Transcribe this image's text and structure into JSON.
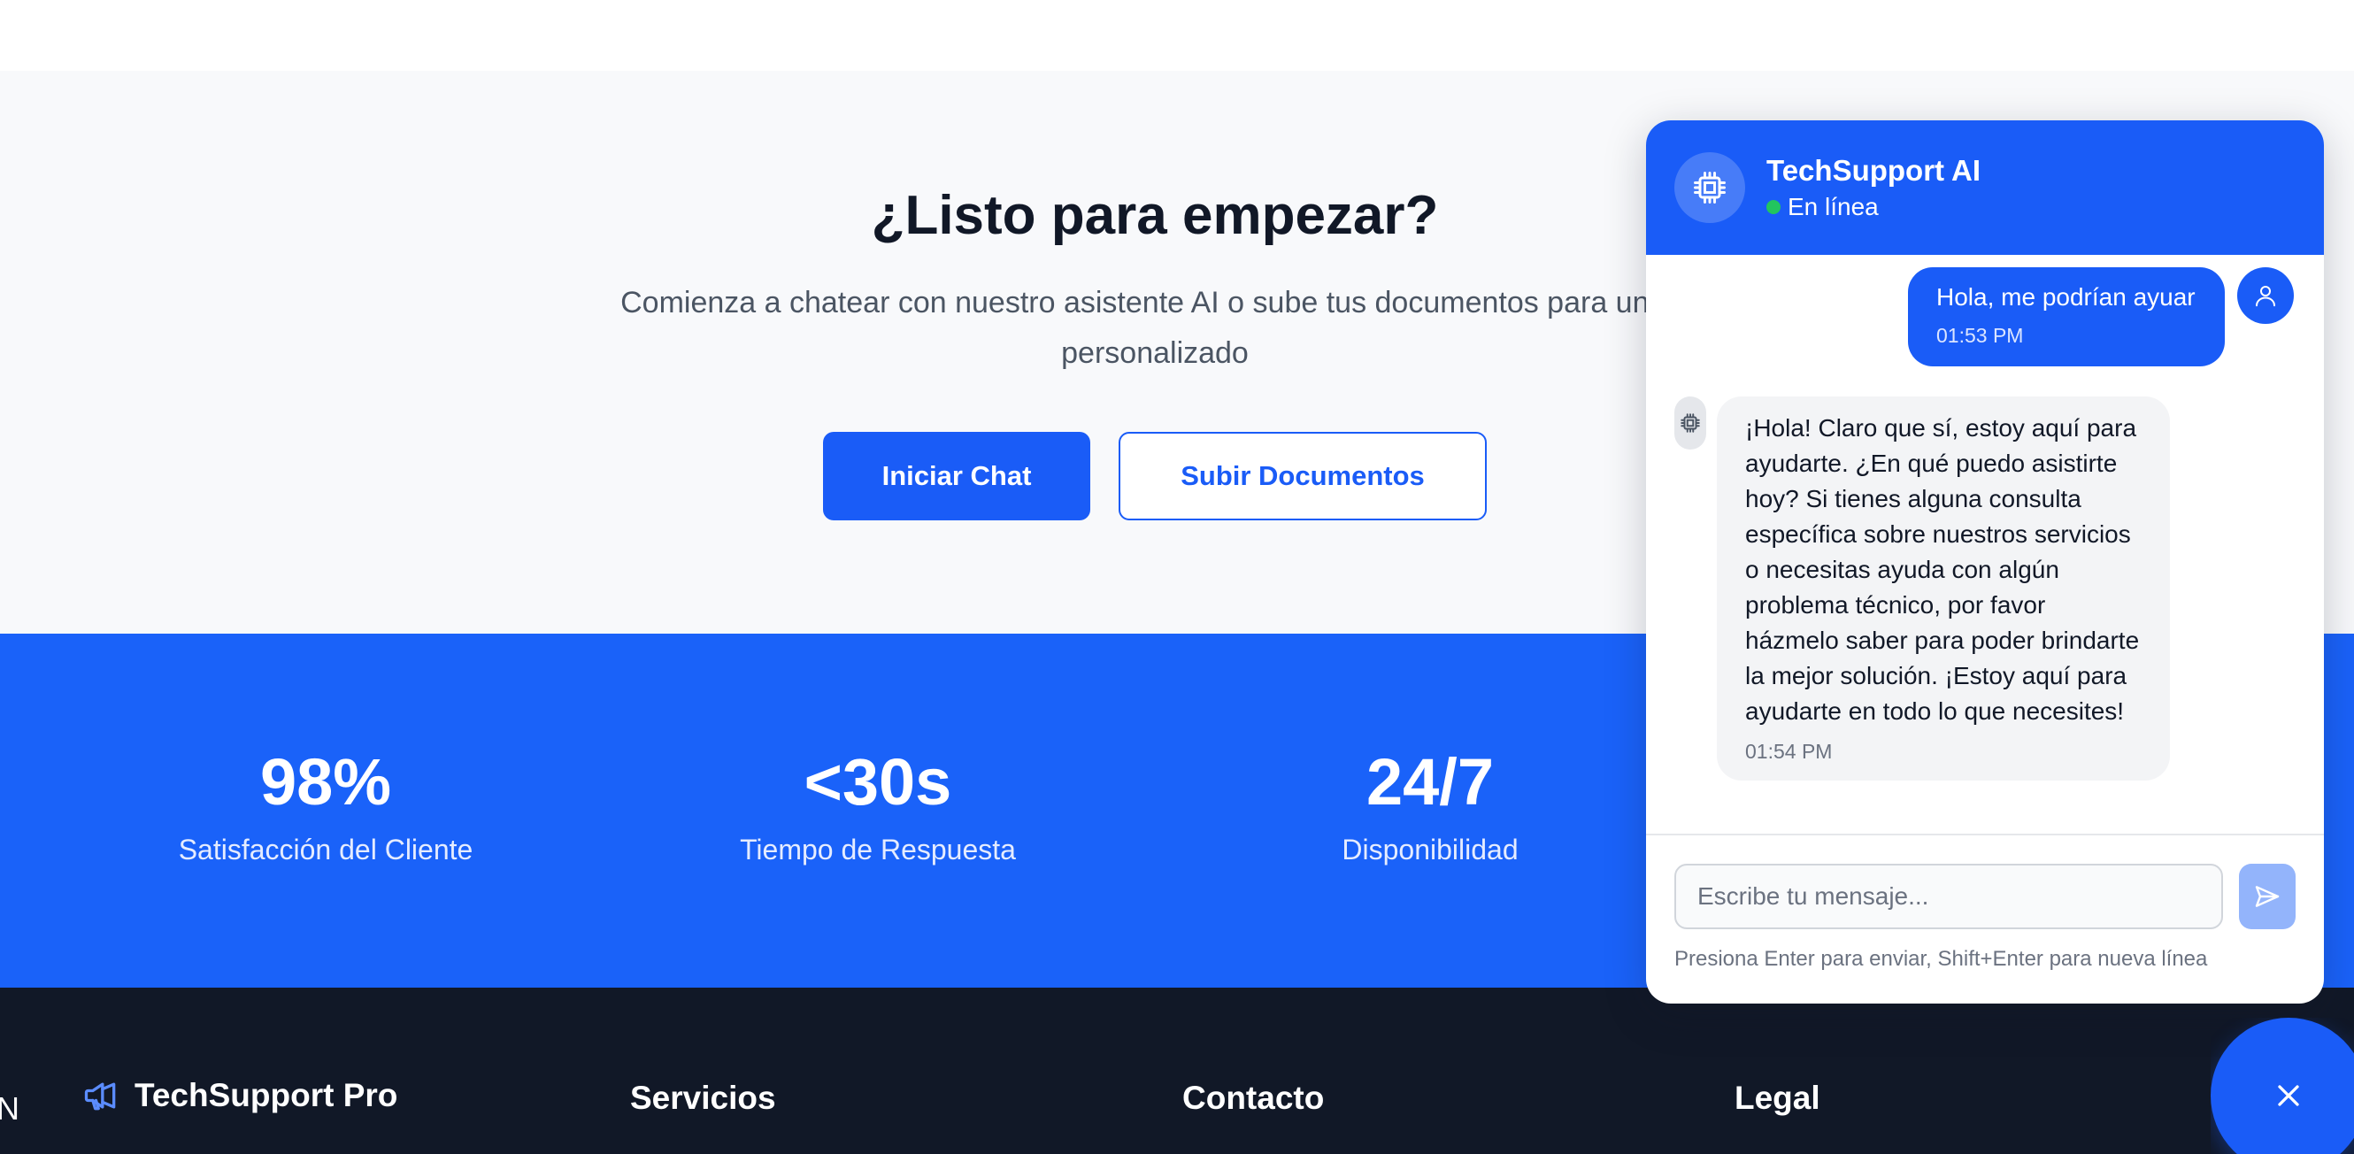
{
  "cta": {
    "title": "¿Listo para empezar?",
    "subtitle_line1": "Comienza a chatear con nuestro asistente AI o sube tus documentos para un so",
    "subtitle_line2": "personalizado",
    "primary_button": "Iniciar Chat",
    "secondary_button": "Subir Documentos"
  },
  "stats": [
    {
      "value": "98%",
      "label": "Satisfacción del Cliente"
    },
    {
      "value": "<30s",
      "label": "Tiempo de Respuesta"
    },
    {
      "value": "24/7",
      "label": "Disponibilidad"
    }
  ],
  "footer": {
    "edge_glyph": "N",
    "brand": "TechSupport Pro",
    "columns": [
      "Servicios",
      "Contacto",
      "Legal"
    ]
  },
  "chat": {
    "title": "TechSupport AI",
    "status": "En línea",
    "messages": [
      {
        "role": "user",
        "text": "Hola, me podrían ayuar",
        "time": "01:53 PM"
      },
      {
        "role": "bot",
        "text": "¡Hola! Claro que sí, estoy aquí para ayudarte. ¿En qué puedo asistirte hoy? Si tienes alguna consulta específica sobre nuestros servicios o necesitas ayuda con algún problema técnico, por favor házmelo saber para poder brindarte la mejor solución. ¡Estoy aquí para ayudarte en todo lo que necesites!",
        "time": "01:54 PM"
      }
    ],
    "input_placeholder": "Escribe tu mensaje...",
    "hint": "Presiona Enter para enviar, Shift+Enter para nueva línea"
  },
  "icons": {
    "chat_avatar": "cpu-chip-icon",
    "user_avatar": "user-icon",
    "send": "send-icon",
    "close": "close-icon",
    "footer_brand": "megaphone-icon"
  },
  "colors": {
    "brand_blue": "#1a5cf7",
    "stats_blue": "#1a62f9",
    "footer_dark": "#111827",
    "online_green": "#22c55e"
  }
}
